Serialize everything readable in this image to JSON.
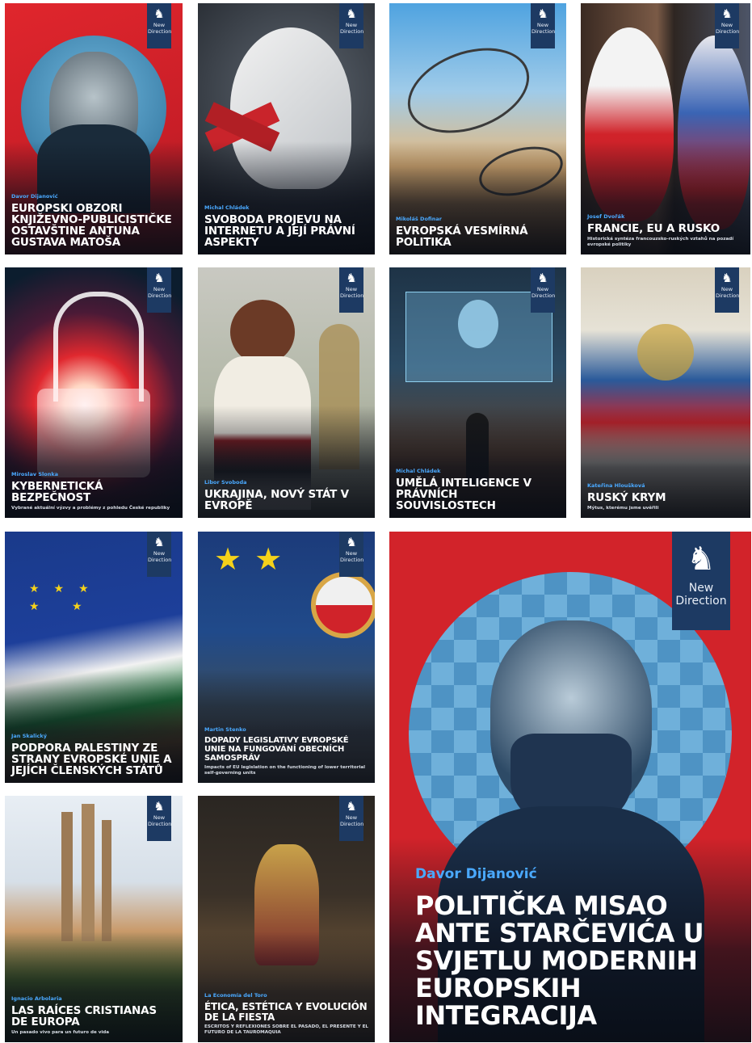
{
  "covers": [
    {
      "id": "c1",
      "author": "Davor Dijanović",
      "title": "EUROPSKI OBZORI KNJIŽEVNO-PUBLICISTIČKE OSTAVŠTINE ANTUNA GUSTAVA MATOŠA",
      "subtitle": ""
    },
    {
      "id": "c2",
      "author": "Michal Chládek",
      "title": "SVOBODA PROJEVU NA INTERNETU A JEJÍ PRÁVNÍ ASPEKTY",
      "subtitle": ""
    },
    {
      "id": "c3",
      "author": "Mikoláš Dofinar",
      "title": "EVROPSKÁ VESMÍRNÁ POLITIKA",
      "subtitle": ""
    },
    {
      "id": "c4",
      "author": "Josef Dvořák",
      "title": "FRANCIE, EU A RUSKO",
      "subtitle": "Historická syntéza francouzsko-ruských vztahů na pozadí evropské politiky"
    },
    {
      "id": "c5",
      "author": "Miroslav Slonka",
      "title": "KYBERNETICKÁ BEZPEČNOST",
      "subtitle": "Vybrané aktuální výzvy a problémy z pohledu České republiky"
    },
    {
      "id": "c6",
      "author": "Libor Svoboda",
      "title": "UKRAJINA, NOVÝ STÁT V EVROPĚ",
      "subtitle": ""
    },
    {
      "id": "c7",
      "author": "Michal Chládek",
      "title": "UMĚLÁ INTELIGENCE V PRÁVNÍCH SOUVISLOSTECH",
      "subtitle": ""
    },
    {
      "id": "c8",
      "author": "Kateřina Hloušková",
      "title": "RUSKÝ KRYM",
      "subtitle": "Mýtus, kterému jsme uvěřili"
    },
    {
      "id": "c9",
      "author": "Jan Skalický",
      "title": "PODPORA PALESTINY ZE STRANY EVROPSKÉ UNIE A JEJÍCH ČLENSKÝCH STÁTŮ",
      "subtitle": ""
    },
    {
      "id": "c10",
      "author": "Martin Stenko",
      "title": "DOPADY LEGISLATIVY EVROPSKÉ UNIE NA FUNGOVÁNÍ OBECNÍCH SAMOSPRÁV",
      "subtitle": "Impacts of EU legislation on the functioning of lower territorial self-governing units"
    },
    {
      "id": "c11",
      "author": "Ignacio Arbolaria",
      "title": "LAS RAÍCES CRISTIANAS DE EUROPA",
      "subtitle": "Un pasado vivo para un futuro de vida"
    },
    {
      "id": "c12",
      "author": "La Economía del Toro",
      "title": "ÉTICA, ESTÉTICA Y EVOLUCIÓN DE LA FIESTA",
      "subtitle": "ESCRITOS Y REFLEXIONES SOBRE EL PASADO, EL PRESENTE Y EL FUTURO DE LA TAUROMAQUIA"
    },
    {
      "id": "c15",
      "author": "Davor Dijanović",
      "title": "POLITIČKA MISAO ANTE STARČEVIĆA U SVJETLU MODERNIH EUROPSKIH INTEGRACIJA",
      "subtitle": ""
    }
  ],
  "brand": {
    "mark": "♞",
    "name": "New Direction"
  },
  "colors": {
    "brand_navy": "#1d3a63",
    "author_blue": "#4aa9ff",
    "accent_red": "#d2232a"
  }
}
